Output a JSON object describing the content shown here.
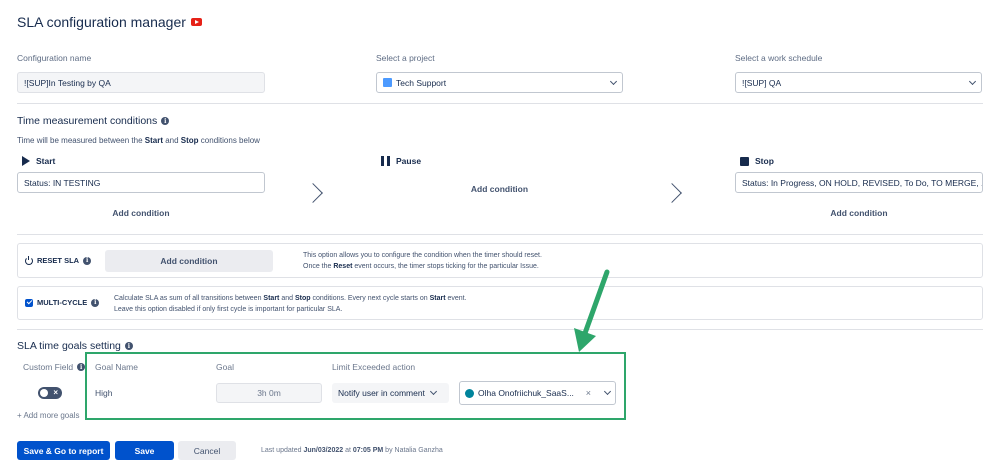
{
  "header": {
    "title": "SLA configuration manager",
    "title_icon": "youtube-icon"
  },
  "config_name": {
    "label": "Configuration name",
    "value": "![SUP]In Testing by QA"
  },
  "project": {
    "label": "Select a project",
    "value": "Tech Support"
  },
  "schedule": {
    "label": "Select a work schedule",
    "value": "![SUP] QA"
  },
  "time_measurement": {
    "title": "Time measurement conditions",
    "description_prefix": "Time will be measured between the ",
    "start_word": "Start",
    "description_mid": " and ",
    "stop_word": "Stop",
    "description_suffix": " conditions below",
    "start": {
      "label": "Start",
      "condition": "Status: IN TESTING",
      "add": "Add condition"
    },
    "pause": {
      "label": "Pause",
      "add": "Add condition"
    },
    "stop": {
      "label": "Stop",
      "condition": "Status: In Progress, ON HOLD, REVISED, To Do, TO MERGE, ...",
      "add": "Add condition"
    }
  },
  "reset_sla": {
    "label": "RESET SLA",
    "button": "Add condition",
    "help_line1": "This option allows you to configure the condition when the timer should reset.",
    "help_line2_prefix": "Once the ",
    "help_line2_bold": "Reset",
    "help_line2_suffix": " event occurs, the timer stops ticking for the particular Issue."
  },
  "multi_cycle": {
    "label": "MULTI-CYCLE",
    "checked": true,
    "help_line1_a": "Calculate SLA as sum of all transitions between ",
    "help_line1_b": "Start",
    "help_line1_c": " and ",
    "help_line1_d": "Stop",
    "help_line1_e": " conditions. Every next cycle starts on ",
    "help_line1_f": "Start",
    "help_line1_g": " event.",
    "help_line2": "Leave this option disabled if only first cycle is important for particular SLA."
  },
  "goals": {
    "title": "SLA time goals setting",
    "custom_field_label": "Custom Field",
    "columns": {
      "name": "Goal Name",
      "goal": "Goal",
      "action": "Limit Exceeded action"
    },
    "row": {
      "name": "High",
      "goal": "3h 0m",
      "action": "Notify user in comment",
      "user": "Olha Onofriichuk_SaaS..."
    },
    "add_more": "+ Add more goals"
  },
  "footer": {
    "save_go": "Save & Go to report",
    "save": "Save",
    "cancel": "Cancel",
    "updated_prefix": "Last updated ",
    "updated_date": "Jun/03/2022",
    "updated_at": " at ",
    "updated_time": "07:05 PM",
    "updated_by": " by Natalia Ganzha"
  },
  "colors": {
    "primary": "#0052cc",
    "highlight": "#2ea66b",
    "accent_arrow": "#2ea66b"
  }
}
